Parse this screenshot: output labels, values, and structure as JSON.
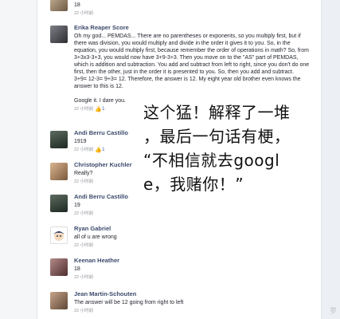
{
  "comments": [
    {
      "name": "",
      "text": "18",
      "meta": "22 小时前",
      "likes": ""
    },
    {
      "name": "Erika Reaper Score",
      "text": "Oh my god... PEMDAS... There are no parentheses or exponents, so you multiply first, but if there was division, you would multiply and divide in the order it gives it to you. So, in the equation, you would multiply first, because remember the order of operations in math? So, from 3+3x3-3+3, you would now have 3+9-3+3. Then you move on to the \"AS\" part of PEMDAS, which is addition and subtraction. You add and subtract from left to right, since you don't do one first, then the other, just in the order it is presented to you. So, then you add and subtract.\n3+9= 12-3= 9+3= 12. Therefore, the answer is 12. My eight year old brother even knows the answer to this is 12.\n\nGoogle it. I dare you.",
      "meta": "22 小时前",
      "likes": "1"
    },
    {
      "name": "Andi Berru Castillo",
      "text": "1919",
      "meta": "22 小时前",
      "likes": "1"
    },
    {
      "name": "Christopher Kuchler",
      "text": "Really?",
      "meta": "22 小时前",
      "likes": ""
    },
    {
      "name": "Andi Berru Castillo",
      "text": "19",
      "meta": "22 小时前",
      "likes": ""
    },
    {
      "name": "Ryan Gabriel",
      "text": "all of u are wrong",
      "meta": "22 小时前",
      "likes": ""
    },
    {
      "name": "Keenan Heather",
      "text": "18",
      "meta": "22 小时前",
      "likes": ""
    },
    {
      "name": "Jean Martin-Schouten",
      "text": "The answer will be 12 going from right to left",
      "meta": "22 小时前",
      "likes": ""
    }
  ],
  "annotation": "这个猛！解释了一堆\n，最后一句话有梗，\n“不相信就去googl\ne，我赌你！”",
  "corner_mark": "罗",
  "colors": {
    "name": "#3b4a6b",
    "like": "#4267b2",
    "meta": "#90949c"
  },
  "icons": {
    "like": "thumbs-up-icon"
  }
}
